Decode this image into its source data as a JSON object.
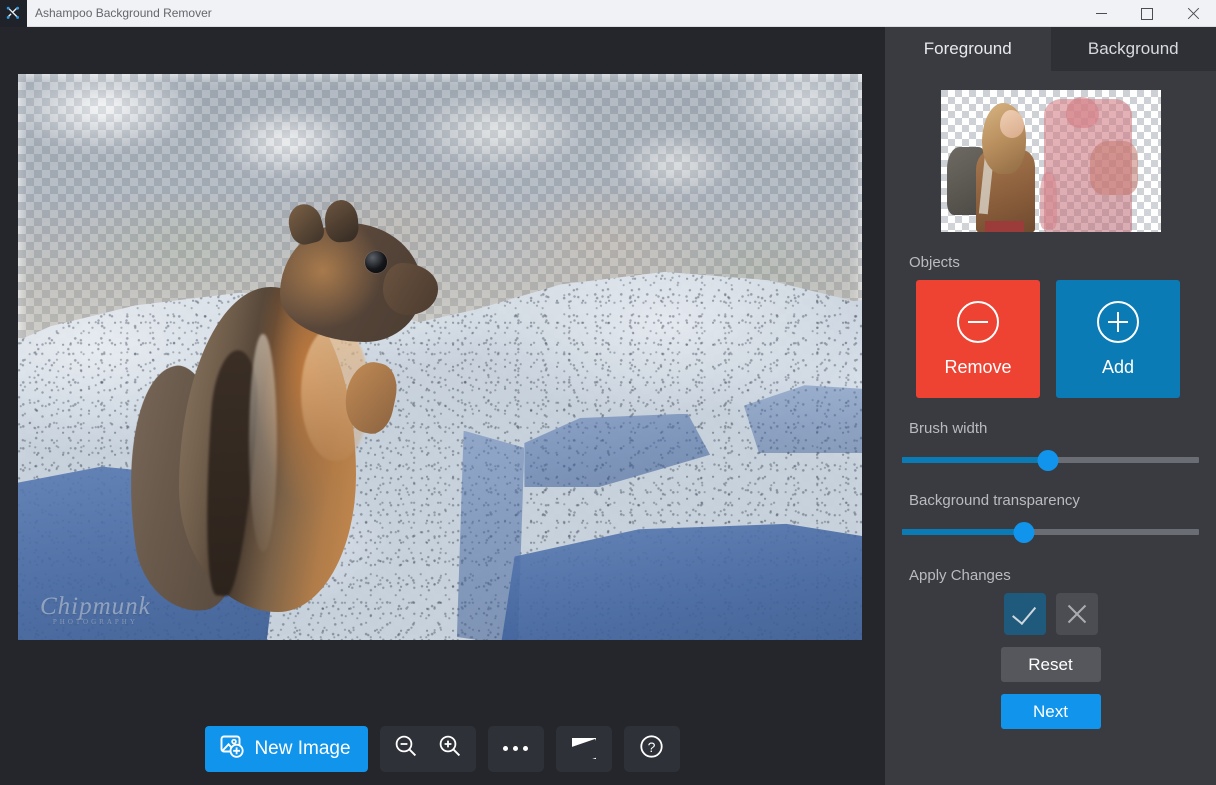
{
  "window": {
    "title": "Ashampoo Background Remover",
    "app_icon": "scissors-icon",
    "controls": {
      "minimize": "minimize-icon",
      "maximize": "maximize-icon",
      "close": "close-icon"
    }
  },
  "canvas": {
    "subject": "chipmunk-on-rock",
    "watermark": "Chipmunk",
    "watermark_sub": "PHOTOGRAPHY",
    "transparency_checkerboard": true
  },
  "toolbar": {
    "new_image_label": "New Image",
    "new_image_icon": "add-image-icon",
    "zoom_out_icon": "zoom-out-icon",
    "zoom_in_icon": "zoom-in-icon",
    "more_icon": "more-options-icon",
    "compare_icon": "compare-split-icon",
    "help_icon": "help-icon"
  },
  "panel": {
    "tabs": [
      {
        "label": "Foreground",
        "active": true
      },
      {
        "label": "Background",
        "active": false
      }
    ],
    "preview": {
      "alt": "couple-hikers-preview",
      "keep_label": "woman-kept",
      "remove_label": "man-marked-for-removal"
    },
    "objects": {
      "label": "Objects",
      "remove_label": "Remove",
      "remove_icon": "minus-circle-icon",
      "add_label": "Add",
      "add_icon": "plus-circle-icon"
    },
    "brush_width": {
      "label": "Brush width",
      "value": 49
    },
    "background_transparency": {
      "label": "Background transparency",
      "value": 41
    },
    "apply_changes": {
      "label": "Apply Changes",
      "confirm_icon": "check-icon",
      "cancel_icon": "x-icon",
      "reset_label": "Reset",
      "next_label": "Next"
    }
  },
  "colors": {
    "titlebar_bg": "#f0f2f5",
    "workarea_bg": "#24262b",
    "panel_bg": "#3a3b41",
    "tab_inactive_bg": "#2e3036",
    "accent_blue": "#1195ec",
    "add_blue": "#0b7bb5",
    "remove_red": "#ee4233",
    "confirm_teal": "#1f5a7d",
    "neutral_gray": "#55575d"
  }
}
